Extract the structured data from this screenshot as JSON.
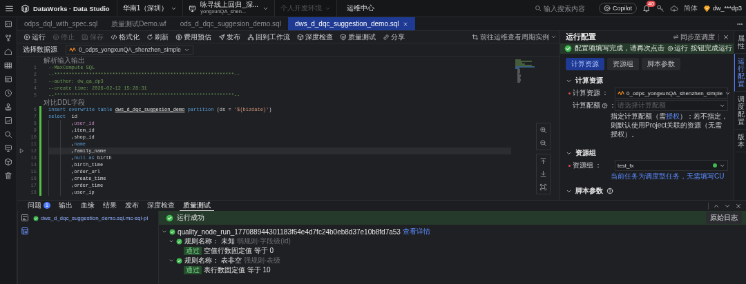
{
  "topbar": {
    "brand": "DataWorks · Data Studio",
    "region": "华南1（深圳）",
    "workspace": {
      "name": "咏寻线上回归_深...",
      "id": "yongxunQA_shen..."
    },
    "environment": {
      "label": "个人开发环境",
      "disabled": true
    },
    "ops_center": "运维中心",
    "search": {
      "placeholder": "输入搜索内容"
    },
    "copilot": "Copilot",
    "notification_badge": "40",
    "language": "简体",
    "user": "dw_***dp3"
  },
  "file_tabs": [
    {
      "label": "odps_dql_with_spec.sql",
      "selected": false
    },
    {
      "label": "质量测试Demo.wf",
      "selected": false
    },
    {
      "label": "ods_d_dqc_suggesion_demo.sql",
      "selected": false
    },
    {
      "label": "dws_d_dqc_suggestion_demo.sql",
      "selected": true
    }
  ],
  "toolbar": {
    "actions": [
      {
        "kind": "run",
        "label": "运行",
        "disabled": false
      },
      {
        "kind": "stop",
        "label": "停止",
        "disabled": true
      },
      {
        "kind": "save",
        "label": "保存",
        "disabled": true
      },
      {
        "kind": "format",
        "label": "格式化",
        "disabled": false
      },
      {
        "kind": "refresh",
        "label": "刷新",
        "disabled": false
      },
      {
        "kind": "cost",
        "label": "费用预估",
        "disabled": false
      },
      {
        "kind": "publish",
        "label": "发布",
        "disabled": false
      },
      {
        "kind": "workflow",
        "label": "回到工作流",
        "disabled": false
      },
      {
        "kind": "inspect",
        "label": "深度检查",
        "disabled": false
      },
      {
        "kind": "quality",
        "label": "质量测试",
        "disabled": false
      },
      {
        "kind": "share",
        "label": "分享",
        "disabled": false
      }
    ],
    "ops_link": "前往运维查看周期实例"
  },
  "datasource": {
    "label": "选择数据源",
    "value": "0_odps_yongxunQA_shenzhen_simple"
  },
  "editor": {
    "lines": [
      {
        "number": "1",
        "annotation": "解析输入输出",
        "changed": false,
        "current": false,
        "indented": false,
        "tokens": [
          {
            "kind": "comment",
            "text": "--MaxCompute SQL"
          }
        ]
      },
      {
        "number": "2",
        "changed": false,
        "current": false,
        "indented": false,
        "tokens": [
          {
            "kind": "comment",
            "text": "--**************************************************************--"
          }
        ]
      },
      {
        "number": "3",
        "changed": false,
        "current": false,
        "indented": false,
        "tokens": [
          {
            "kind": "comment",
            "text": "--author: dw_qa_dp3"
          }
        ]
      },
      {
        "number": "4",
        "changed": false,
        "current": false,
        "indented": false,
        "tokens": [
          {
            "kind": "comment",
            "text": "--create time: 2026-02-12 15:28:31"
          }
        ]
      },
      {
        "number": "5",
        "changed": false,
        "current": false,
        "indented": false,
        "tokens": [
          {
            "kind": "comment",
            "text": "--**************************************************************--"
          }
        ]
      },
      {
        "number": "6",
        "annotation": "对比DDL字段",
        "changed": true,
        "current": false,
        "indented": false,
        "tokens": [
          {
            "kind": "keyword",
            "text": "insert overwrite table "
          },
          {
            "kind": "table",
            "text": "dws_d_dqc_suggesion_demo"
          },
          {
            "kind": "keyword",
            "text": " partition"
          },
          {
            "kind": "plain",
            "text": " (ds = "
          },
          {
            "kind": "string",
            "text": "'${bizdate}'"
          },
          {
            "kind": "plain",
            "text": ")"
          }
        ]
      },
      {
        "number": "7",
        "changed": true,
        "current": false,
        "indented": false,
        "tokens": [
          {
            "kind": "keyword",
            "text": "select"
          },
          {
            "kind": "plain",
            "text": "  id"
          }
        ]
      },
      {
        "number": "8",
        "changed": true,
        "current": false,
        "indented": true,
        "tokens": [
          {
            "kind": "plain",
            "text": ","
          },
          {
            "kind": "field",
            "text": "user_id"
          }
        ]
      },
      {
        "number": "9",
        "changed": true,
        "current": false,
        "indented": true,
        "tokens": [
          {
            "kind": "plain",
            "text": ",item_id"
          }
        ]
      },
      {
        "number": "10",
        "changed": true,
        "current": false,
        "indented": true,
        "tokens": [
          {
            "kind": "plain",
            "text": ",shop_id"
          }
        ]
      },
      {
        "number": "11",
        "changed": true,
        "current": false,
        "indented": true,
        "tokens": [
          {
            "kind": "plain",
            "text": ","
          },
          {
            "kind": "keyword",
            "text": "name"
          }
        ]
      },
      {
        "number": "12",
        "changed": true,
        "current": true,
        "indented": true,
        "tokens": [
          {
            "kind": "plain",
            "text": ",family_name"
          }
        ]
      },
      {
        "number": "13",
        "changed": true,
        "current": false,
        "indented": true,
        "tokens": [
          {
            "kind": "plain",
            "text": ","
          },
          {
            "kind": "keyword",
            "text": "null as"
          },
          {
            "kind": "plain",
            "text": " birth"
          }
        ]
      },
      {
        "number": "14",
        "changed": true,
        "current": false,
        "indented": true,
        "tokens": [
          {
            "kind": "plain",
            "text": ",birth_time"
          }
        ]
      },
      {
        "number": "15",
        "changed": true,
        "current": false,
        "indented": true,
        "tokens": [
          {
            "kind": "plain",
            "text": ",order_url"
          }
        ]
      },
      {
        "number": "16",
        "changed": true,
        "current": false,
        "indented": true,
        "tokens": [
          {
            "kind": "plain",
            "text": ",create_time"
          }
        ]
      },
      {
        "number": "17",
        "changed": true,
        "current": false,
        "indented": true,
        "tokens": [
          {
            "kind": "plain",
            "text": ",order_time"
          }
        ]
      },
      {
        "number": "18",
        "changed": true,
        "current": false,
        "indented": true,
        "tokens": [
          {
            "kind": "plain",
            "text": ",user_ip"
          }
        ]
      }
    ]
  },
  "run_config": {
    "title": "运行配置",
    "sync": "同步至调度",
    "notice": {
      "before": "配置项填写完成，请再次点击",
      "action": "运行",
      "after": "按钮完成运行"
    },
    "tabs": [
      {
        "label": "计算资源",
        "selected": true
      },
      {
        "label": "资源组",
        "selected": false
      },
      {
        "label": "脚本参数",
        "selected": false
      }
    ],
    "sections": [
      {
        "title": "计算资源",
        "expanded": true,
        "help": false,
        "fields": [
          {
            "kind": "datasource",
            "label": "计算资源",
            "colon": "：",
            "required": true,
            "help": false,
            "value": "0_odps_yongxunQA_shenzhen_simple"
          },
          {
            "kind": "select",
            "label": "计算配额",
            "colon": "：",
            "required": false,
            "help": true,
            "placeholder": "请选择计算配额"
          }
        ],
        "note": [
          {
            "text": "指定计算配额（需",
            "link": false
          },
          {
            "text": "授权",
            "link": true
          },
          {
            "text": "）：若不指定，则默认使用Project关联的资源（无需授权）。",
            "link": false
          }
        ]
      },
      {
        "title": "资源组",
        "expanded": true,
        "help": false,
        "fields": [
          {
            "kind": "status",
            "label": "资源组",
            "colon": "：",
            "required": true,
            "help": false,
            "value": "test_fx"
          }
        ],
        "note": [
          {
            "text": "当前任务为调度型任务，无需填写CU",
            "link": true
          }
        ]
      },
      {
        "title": "脚本参数",
        "expanded": true,
        "help": true
      }
    ]
  },
  "side_tabs": [
    {
      "label": "属性",
      "selected": false
    },
    {
      "label": "运行配置",
      "selected": true
    },
    {
      "label": "调度配置",
      "selected": false
    },
    {
      "label": "版本",
      "selected": false
    }
  ],
  "bottom_panel": {
    "tabs": [
      {
        "label": "问题",
        "badge": "1",
        "selected": false
      },
      {
        "label": "输出",
        "selected": false
      },
      {
        "label": "血缘",
        "selected": false
      },
      {
        "label": "结果",
        "selected": false
      },
      {
        "label": "发布",
        "selected": false
      },
      {
        "label": "深度检查",
        "selected": false
      },
      {
        "label": "质量测试",
        "selected": true
      }
    ],
    "files": [
      {
        "name": "dws_d_dqc_suggestion_demo.sql.mc-sql-pl"
      }
    ],
    "result": {
      "status": "运行成功",
      "log_button": "原始日志",
      "tree": [
        {
          "kind": "run",
          "text": "quality_node_run_177088944301183f64e4d7fc24b0eb8d37e10b8fd7a53",
          "link": "查看详情",
          "expanded": true,
          "children": [
            {
              "kind": "rule",
              "label": "规则名称：",
              "name": "未知",
              "meta": "弱规则·字段级(id)",
              "expanded": true,
              "children": [
                {
                  "kind": "check",
                  "badge": "通过",
                  "text": "空值行数固定值 等于 0"
                }
              ]
            },
            {
              "kind": "rule",
              "label": "规则名称：",
              "name": "表非空",
              "meta": "强规则·表级",
              "expanded": true,
              "children": [
                {
                  "kind": "check",
                  "badge": "通过",
                  "text": "表行数固定值 等于 10"
                }
              ]
            }
          ]
        }
      ]
    }
  }
}
